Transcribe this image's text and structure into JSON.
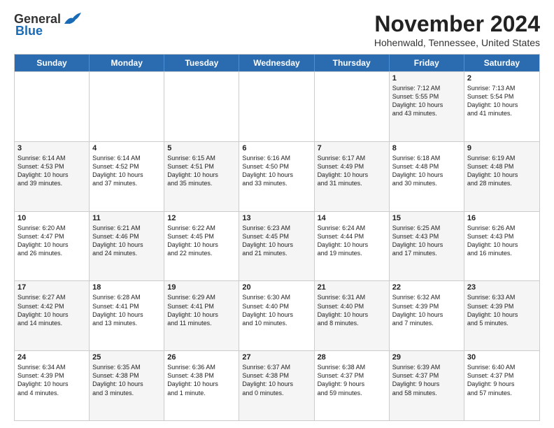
{
  "header": {
    "logo_general": "General",
    "logo_blue": "Blue",
    "month_title": "November 2024",
    "location": "Hohenwald, Tennessee, United States"
  },
  "days_of_week": [
    "Sunday",
    "Monday",
    "Tuesday",
    "Wednesday",
    "Thursday",
    "Friday",
    "Saturday"
  ],
  "weeks": [
    [
      {
        "day": "",
        "info": "",
        "empty": true
      },
      {
        "day": "",
        "info": "",
        "empty": true
      },
      {
        "day": "",
        "info": "",
        "empty": true
      },
      {
        "day": "",
        "info": "",
        "empty": true
      },
      {
        "day": "",
        "info": "",
        "empty": true
      },
      {
        "day": "1",
        "info": "Sunrise: 7:12 AM\nSunset: 5:55 PM\nDaylight: 10 hours\nand 43 minutes.",
        "shaded": true
      },
      {
        "day": "2",
        "info": "Sunrise: 7:13 AM\nSunset: 5:54 PM\nDaylight: 10 hours\nand 41 minutes.",
        "shaded": false
      }
    ],
    [
      {
        "day": "3",
        "info": "Sunrise: 6:14 AM\nSunset: 4:53 PM\nDaylight: 10 hours\nand 39 minutes.",
        "shaded": true
      },
      {
        "day": "4",
        "info": "Sunrise: 6:14 AM\nSunset: 4:52 PM\nDaylight: 10 hours\nand 37 minutes.",
        "shaded": false
      },
      {
        "day": "5",
        "info": "Sunrise: 6:15 AM\nSunset: 4:51 PM\nDaylight: 10 hours\nand 35 minutes.",
        "shaded": true
      },
      {
        "day": "6",
        "info": "Sunrise: 6:16 AM\nSunset: 4:50 PM\nDaylight: 10 hours\nand 33 minutes.",
        "shaded": false
      },
      {
        "day": "7",
        "info": "Sunrise: 6:17 AM\nSunset: 4:49 PM\nDaylight: 10 hours\nand 31 minutes.",
        "shaded": true
      },
      {
        "day": "8",
        "info": "Sunrise: 6:18 AM\nSunset: 4:48 PM\nDaylight: 10 hours\nand 30 minutes.",
        "shaded": false
      },
      {
        "day": "9",
        "info": "Sunrise: 6:19 AM\nSunset: 4:48 PM\nDaylight: 10 hours\nand 28 minutes.",
        "shaded": true
      }
    ],
    [
      {
        "day": "10",
        "info": "Sunrise: 6:20 AM\nSunset: 4:47 PM\nDaylight: 10 hours\nand 26 minutes.",
        "shaded": false
      },
      {
        "day": "11",
        "info": "Sunrise: 6:21 AM\nSunset: 4:46 PM\nDaylight: 10 hours\nand 24 minutes.",
        "shaded": true
      },
      {
        "day": "12",
        "info": "Sunrise: 6:22 AM\nSunset: 4:45 PM\nDaylight: 10 hours\nand 22 minutes.",
        "shaded": false
      },
      {
        "day": "13",
        "info": "Sunrise: 6:23 AM\nSunset: 4:45 PM\nDaylight: 10 hours\nand 21 minutes.",
        "shaded": true
      },
      {
        "day": "14",
        "info": "Sunrise: 6:24 AM\nSunset: 4:44 PM\nDaylight: 10 hours\nand 19 minutes.",
        "shaded": false
      },
      {
        "day": "15",
        "info": "Sunrise: 6:25 AM\nSunset: 4:43 PM\nDaylight: 10 hours\nand 17 minutes.",
        "shaded": true
      },
      {
        "day": "16",
        "info": "Sunrise: 6:26 AM\nSunset: 4:43 PM\nDaylight: 10 hours\nand 16 minutes.",
        "shaded": false
      }
    ],
    [
      {
        "day": "17",
        "info": "Sunrise: 6:27 AM\nSunset: 4:42 PM\nDaylight: 10 hours\nand 14 minutes.",
        "shaded": true
      },
      {
        "day": "18",
        "info": "Sunrise: 6:28 AM\nSunset: 4:41 PM\nDaylight: 10 hours\nand 13 minutes.",
        "shaded": false
      },
      {
        "day": "19",
        "info": "Sunrise: 6:29 AM\nSunset: 4:41 PM\nDaylight: 10 hours\nand 11 minutes.",
        "shaded": true
      },
      {
        "day": "20",
        "info": "Sunrise: 6:30 AM\nSunset: 4:40 PM\nDaylight: 10 hours\nand 10 minutes.",
        "shaded": false
      },
      {
        "day": "21",
        "info": "Sunrise: 6:31 AM\nSunset: 4:40 PM\nDaylight: 10 hours\nand 8 minutes.",
        "shaded": true
      },
      {
        "day": "22",
        "info": "Sunrise: 6:32 AM\nSunset: 4:39 PM\nDaylight: 10 hours\nand 7 minutes.",
        "shaded": false
      },
      {
        "day": "23",
        "info": "Sunrise: 6:33 AM\nSunset: 4:39 PM\nDaylight: 10 hours\nand 5 minutes.",
        "shaded": true
      }
    ],
    [
      {
        "day": "24",
        "info": "Sunrise: 6:34 AM\nSunset: 4:39 PM\nDaylight: 10 hours\nand 4 minutes.",
        "shaded": false
      },
      {
        "day": "25",
        "info": "Sunrise: 6:35 AM\nSunset: 4:38 PM\nDaylight: 10 hours\nand 3 minutes.",
        "shaded": true
      },
      {
        "day": "26",
        "info": "Sunrise: 6:36 AM\nSunset: 4:38 PM\nDaylight: 10 hours\nand 1 minute.",
        "shaded": false
      },
      {
        "day": "27",
        "info": "Sunrise: 6:37 AM\nSunset: 4:38 PM\nDaylight: 10 hours\nand 0 minutes.",
        "shaded": true
      },
      {
        "day": "28",
        "info": "Sunrise: 6:38 AM\nSunset: 4:37 PM\nDaylight: 9 hours\nand 59 minutes.",
        "shaded": false
      },
      {
        "day": "29",
        "info": "Sunrise: 6:39 AM\nSunset: 4:37 PM\nDaylight: 9 hours\nand 58 minutes.",
        "shaded": true
      },
      {
        "day": "30",
        "info": "Sunrise: 6:40 AM\nSunset: 4:37 PM\nDaylight: 9 hours\nand 57 minutes.",
        "shaded": false
      }
    ]
  ]
}
